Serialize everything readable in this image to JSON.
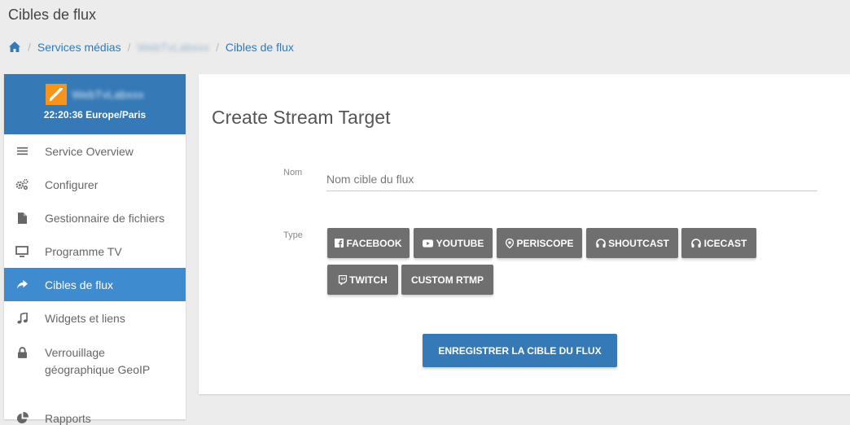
{
  "page": {
    "title": "Cibles de flux"
  },
  "breadcrumb": {
    "items": [
      "Services médias",
      "WebTvLabxxx",
      "Cibles de flux"
    ]
  },
  "sidebar": {
    "service_name": "WebTvLabxxx",
    "time": "22:20:36 Europe/Paris",
    "items": [
      {
        "label": "Service Overview",
        "icon": "list-icon"
      },
      {
        "label": "Configurer",
        "icon": "gears-icon"
      },
      {
        "label": "Gestionnaire de fichiers",
        "icon": "file-icon"
      },
      {
        "label": "Programme TV",
        "icon": "monitor-icon"
      },
      {
        "label": "Cibles de flux",
        "icon": "share-icon",
        "active": true
      },
      {
        "label": "Widgets et liens",
        "icon": "music-icon"
      },
      {
        "label": "Verrouillage géographique GeoIP",
        "icon": "lock-icon"
      },
      {
        "label": "Rapports",
        "icon": "pie-chart-icon"
      }
    ]
  },
  "form": {
    "title": "Create Stream Target",
    "name_label": "Nom",
    "name_placeholder": "Nom cible du flux",
    "type_label": "Type",
    "types": [
      "FACEBOOK",
      "YOUTUBE",
      "PERISCOPE",
      "SHOUTCAST",
      "ICECAST",
      "TWITCH",
      "CUSTOM RTMP"
    ],
    "save_label": "ENREGISTRER LA CIBLE DU FLUX"
  },
  "colors": {
    "primary": "#3579b6",
    "active_menu": "#3f8bd0",
    "type_button": "#6f6f6f",
    "logo": "#f7941d",
    "link": "#337ab7"
  }
}
